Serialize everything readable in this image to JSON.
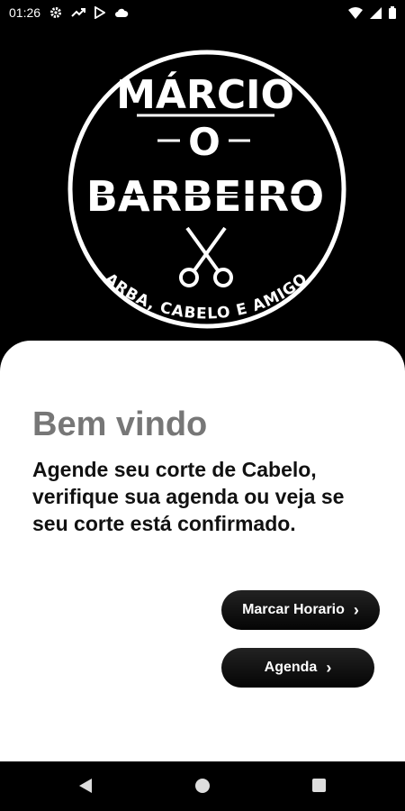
{
  "status_bar": {
    "time": "01:26",
    "icons": [
      "gear-icon",
      "trend-icon",
      "play-store-icon",
      "cloud-icon",
      "wifi-icon",
      "signal-icon",
      "battery-icon"
    ]
  },
  "logo": {
    "line1": "MÁRCIO",
    "line2": "O",
    "line3": "BARBEIRO",
    "tagline": "BARBA, CABELO E AMIGOS",
    "icon": "scissors-icon"
  },
  "main": {
    "welcome": "Bem vindo",
    "description": "Agende seu corte de Cabelo, verifique sua agenda ou veja se seu corte está confirmado."
  },
  "buttons": {
    "marcar_label": "Marcar Horario",
    "agenda_label": "Agenda",
    "chevron": "›"
  },
  "nav": {
    "icons": [
      "back-icon",
      "home-icon",
      "recents-icon"
    ]
  },
  "colors": {
    "background": "#000000",
    "card": "#ffffff",
    "welcome_text": "#777777",
    "body_text": "#111111"
  }
}
